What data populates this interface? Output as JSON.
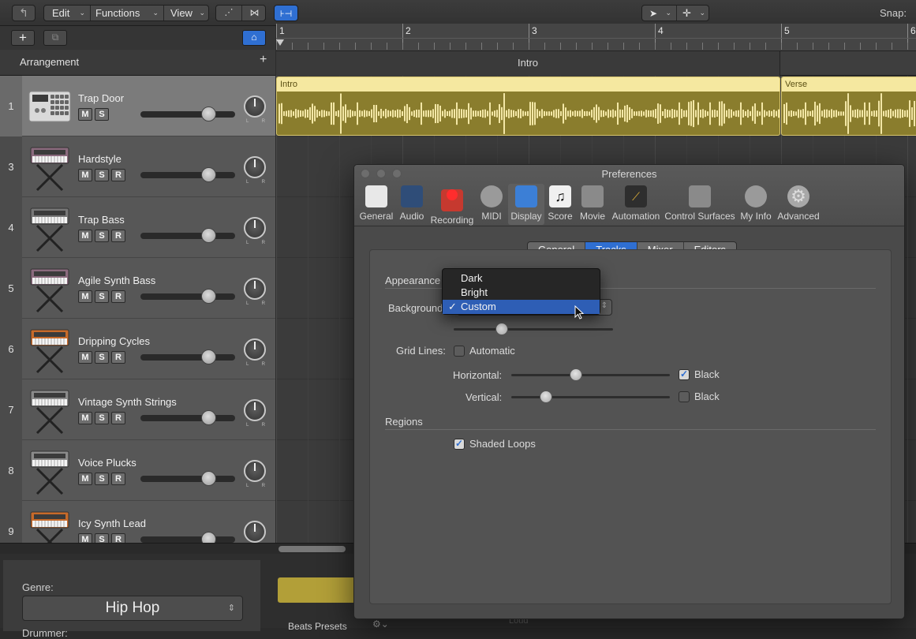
{
  "toolbar": {
    "edit_label": "Edit",
    "functions_label": "Functions",
    "view_label": "View",
    "snap_label": "Snap:"
  },
  "arrangement": {
    "header_label": "Arrangement",
    "add_symbol": "+",
    "markers": [
      "Intro"
    ],
    "ruler_bars": [
      "1",
      "2",
      "3",
      "4",
      "5",
      "6"
    ]
  },
  "tracks": [
    {
      "number": "1",
      "name": "Trap Door",
      "buttons": [
        "M",
        "S"
      ],
      "volume": 0.72,
      "selected": true,
      "icon": "drum-machine-icon"
    },
    {
      "number": "3",
      "name": "Hardstyle",
      "buttons": [
        "M",
        "S",
        "R"
      ],
      "volume": 0.72,
      "icon": "synth-keyboard-icon"
    },
    {
      "number": "4",
      "name": "Trap Bass",
      "buttons": [
        "M",
        "S",
        "R"
      ],
      "volume": 0.72,
      "icon": "synth-keyboard-icon"
    },
    {
      "number": "5",
      "name": "Agile Synth Bass",
      "buttons": [
        "M",
        "S",
        "R"
      ],
      "volume": 0.72,
      "icon": "synth-keyboard-icon"
    },
    {
      "number": "6",
      "name": "Dripping Cycles",
      "buttons": [
        "M",
        "S",
        "R"
      ],
      "volume": 0.72,
      "icon": "synth-keyboard-icon"
    },
    {
      "number": "7",
      "name": "Vintage Synth Strings",
      "buttons": [
        "M",
        "S",
        "R"
      ],
      "volume": 0.72,
      "icon": "synth-keyboard-icon"
    },
    {
      "number": "8",
      "name": "Voice Plucks",
      "buttons": [
        "M",
        "S",
        "R"
      ],
      "volume": 0.72,
      "icon": "synth-keyboard-icon"
    },
    {
      "number": "9",
      "name": "Icy Synth Lead",
      "buttons": [
        "M",
        "S",
        "R"
      ],
      "volume": 0.72,
      "icon": "synth-keyboard-icon"
    }
  ],
  "regions": {
    "intro_label": "Intro",
    "verse_label": "Verse"
  },
  "bottom": {
    "genre_label": "Genre:",
    "genre_value": "Hip Hop",
    "drummer_label": "Drummer:",
    "beats_presets_label": "Beats Presets",
    "loud_label": "Loud"
  },
  "prefs": {
    "title": "Preferences",
    "toolbar_items": [
      "General",
      "Audio",
      "Recording",
      "MIDI",
      "Display",
      "Score",
      "Movie",
      "Automation",
      "Control Surfaces",
      "My Info",
      "Advanced"
    ],
    "selected_item": "Display",
    "tabs": [
      "General",
      "Tracks",
      "Mixer",
      "Editors"
    ],
    "selected_tab": "Tracks",
    "appearance_label": "Appearance",
    "background_label": "Background",
    "background_options": [
      "Dark",
      "Bright",
      "Custom"
    ],
    "background_selected": "Custom",
    "brightness_level": 0.3,
    "grid_lines_label": "Grid Lines:",
    "automatic_label": "Automatic",
    "horizontal_label": "Horizontal:",
    "horizontal_level": 0.41,
    "horizontal_black_label": "Black",
    "horizontal_black_checked": true,
    "vertical_label": "Vertical:",
    "vertical_level": 0.22,
    "vertical_black_label": "Black",
    "vertical_black_checked": false,
    "regions_label": "Regions",
    "shaded_loops_label": "Shaded Loops",
    "shaded_loops_checked": true,
    "check_glyph": "✓"
  }
}
